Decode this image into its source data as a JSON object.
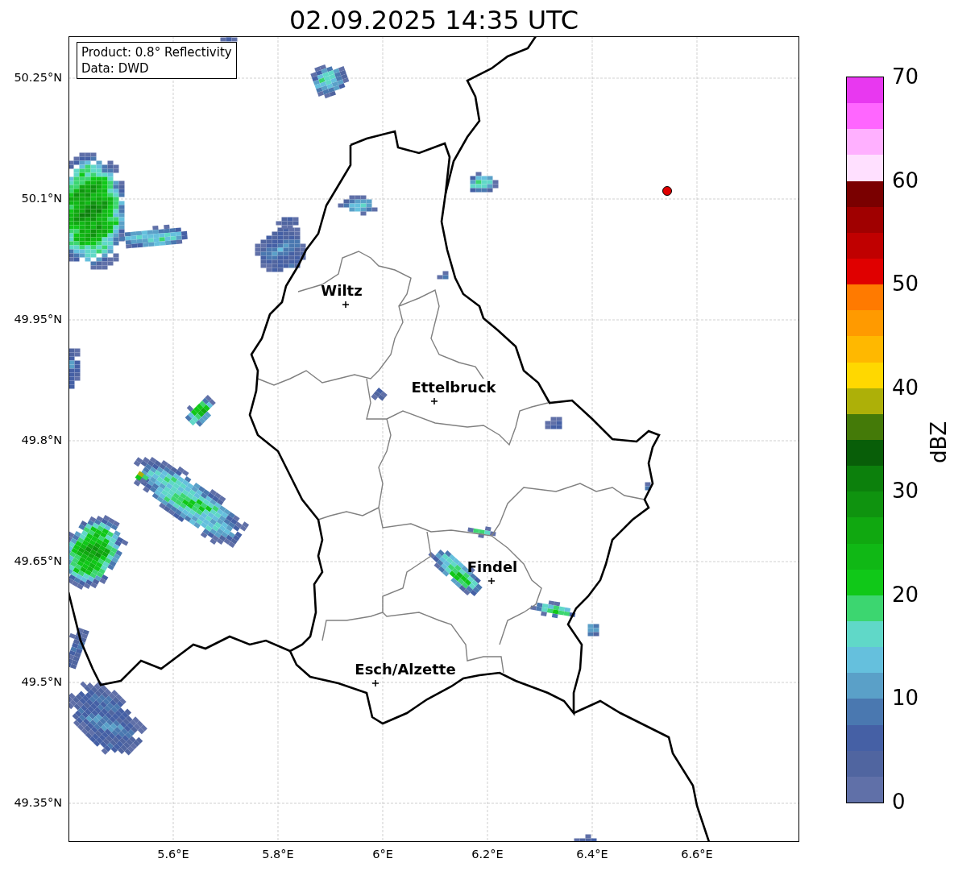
{
  "title": "02.09.2025 14:35 UTC",
  "map": {
    "info": [
      "Product: 0.8° Reflectivity",
      "Data: DWD"
    ],
    "yticks": [
      "50.25°N",
      "50.1°N",
      "49.95°N",
      "49.8°N",
      "49.65°N",
      "49.5°N",
      "49.35°N"
    ],
    "xticks": [
      "5.6°E",
      "5.8°E",
      "6°E",
      "6.2°E",
      "6.4°E",
      "6.6°E"
    ],
    "cities": [
      {
        "name": "Wiltz"
      },
      {
        "name": "Ettelbruck"
      },
      {
        "name": "Findel"
      },
      {
        "name": "Esch/Alzette"
      }
    ]
  },
  "colorbar": {
    "label": "dBZ",
    "ticks": [
      "70",
      "60",
      "50",
      "40",
      "30",
      "20",
      "10",
      "0"
    ],
    "bands": [
      {
        "color": "#e838f0"
      },
      {
        "color": "#ff66ff"
      },
      {
        "color": "#ffb0ff"
      },
      {
        "color": "#ffe0ff"
      },
      {
        "color": "#7a0000"
      },
      {
        "color": "#a00000"
      },
      {
        "color": "#c00000"
      },
      {
        "color": "#e00000"
      },
      {
        "color": "#ff7a00"
      },
      {
        "color": "#ff9a00"
      },
      {
        "color": "#ffb800"
      },
      {
        "color": "#ffd800"
      },
      {
        "color": "#adb008"
      },
      {
        "color": "#447a08"
      },
      {
        "color": "#085e08"
      },
      {
        "color": "#0c800c"
      },
      {
        "color": "#0f930f"
      },
      {
        "color": "#10a810"
      },
      {
        "color": "#10b815"
      },
      {
        "color": "#10c818"
      },
      {
        "color": "#3cd670"
      },
      {
        "color": "#60d8c8"
      },
      {
        "color": "#65c0dd"
      },
      {
        "color": "#5aa0c8"
      },
      {
        "color": "#4a78b0"
      },
      {
        "color": "#4560a5"
      },
      {
        "color": "#5065a0"
      },
      {
        "color": "#6070a8"
      }
    ]
  }
}
